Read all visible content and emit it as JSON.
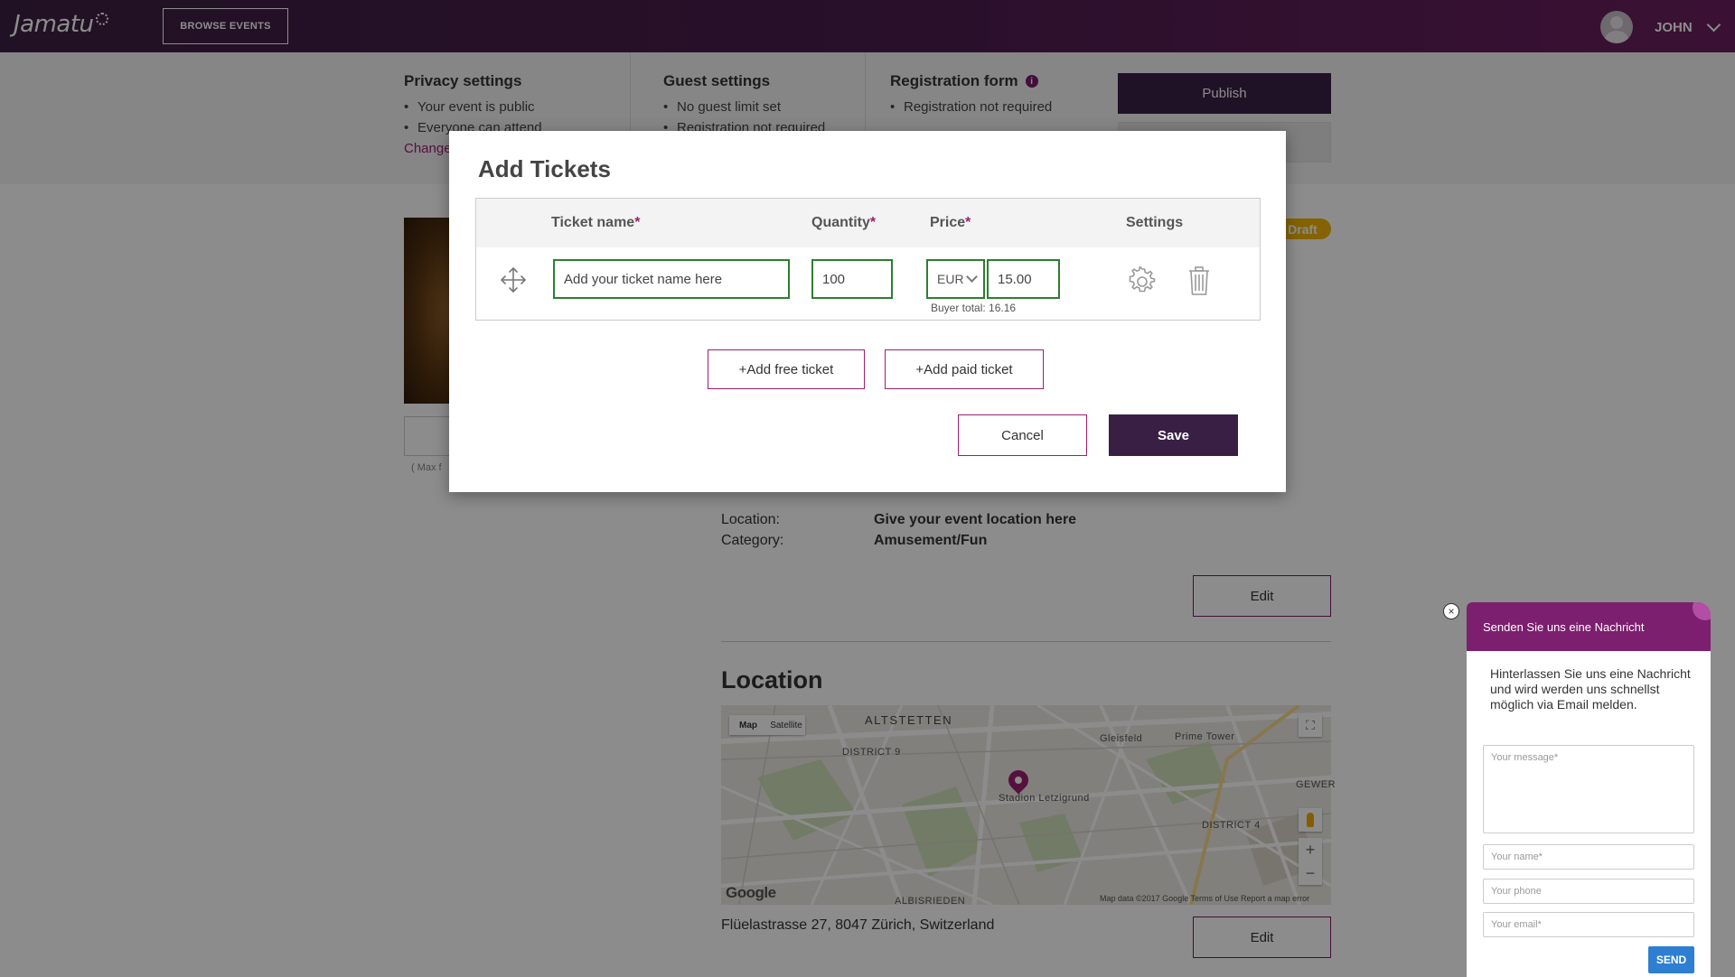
{
  "app": {
    "logo": "Jamatu",
    "browse_events": "BROWSE EVENTS",
    "user_name": "JOHN"
  },
  "settings": {
    "privacy": {
      "title": "Privacy settings",
      "items": [
        "Your event is public",
        "Everyone can attend"
      ],
      "change": "Change"
    },
    "guest": {
      "title": "Guest settings",
      "items": [
        "No guest limit set",
        "Registration not required"
      ]
    },
    "registration": {
      "title": "Registration form",
      "items": [
        "Registration not required"
      ]
    },
    "publish": "Publish"
  },
  "event": {
    "status": "Draft",
    "max_hint": "( Max f",
    "details": [
      {
        "label": "Location:",
        "value": "Give your event location here"
      },
      {
        "label": "Category:",
        "value": "Amusement/Fun"
      }
    ],
    "edit": "Edit",
    "location_title": "Location",
    "address": "Flüelastrasse 27, 8047 Zürich, Switzerland"
  },
  "map": {
    "type_map": "Map",
    "type_satellite": "Satellite",
    "labels": {
      "altstetten": "ALTSTETTEN",
      "district9": "DISTRICT 9",
      "district4": "DISTRICT 4",
      "gleisfeld": "Gleisfeld",
      "prime_tower": "Prime Tower",
      "stadion": "Stadion Letzigrund",
      "albisrieden": "ALBISRIEDEN",
      "gewer": "GEWER"
    },
    "google": "Google",
    "footer": "Map data ©2017 Google   Terms of Use   Report a map error",
    "zoom_in": "+",
    "zoom_out": "−"
  },
  "modal": {
    "title": "Add Tickets",
    "columns": {
      "name": "Ticket name",
      "quantity": "Quantity",
      "price": "Price",
      "settings": "Settings"
    },
    "required_mark": "*",
    "ticket": {
      "name_placeholder": "Add your ticket name here",
      "quantity": "100",
      "currency": "EUR",
      "price": "15.00",
      "buyer_total": "Buyer total: 16.16"
    },
    "add_free": "+Add free ticket",
    "add_paid": "+Add paid ticket",
    "cancel": "Cancel",
    "save": "Save"
  },
  "chat": {
    "close": "×",
    "header": "Senden Sie uns eine Nachricht",
    "intro": "Hinterlassen Sie uns eine Nachricht und wird werden uns schnellst möglich via Email melden.",
    "message_placeholder": "Your message*",
    "name_placeholder": "Your name*",
    "phone_placeholder": "Your phone",
    "email_placeholder": "Your email*",
    "send": "SEND"
  },
  "colors": {
    "brand_dark": "#3a1f45",
    "brand_accent": "#9b1f71",
    "valid_green": "#2e7d32",
    "draft": "#f0b400",
    "send_blue": "#2e7fd1"
  }
}
